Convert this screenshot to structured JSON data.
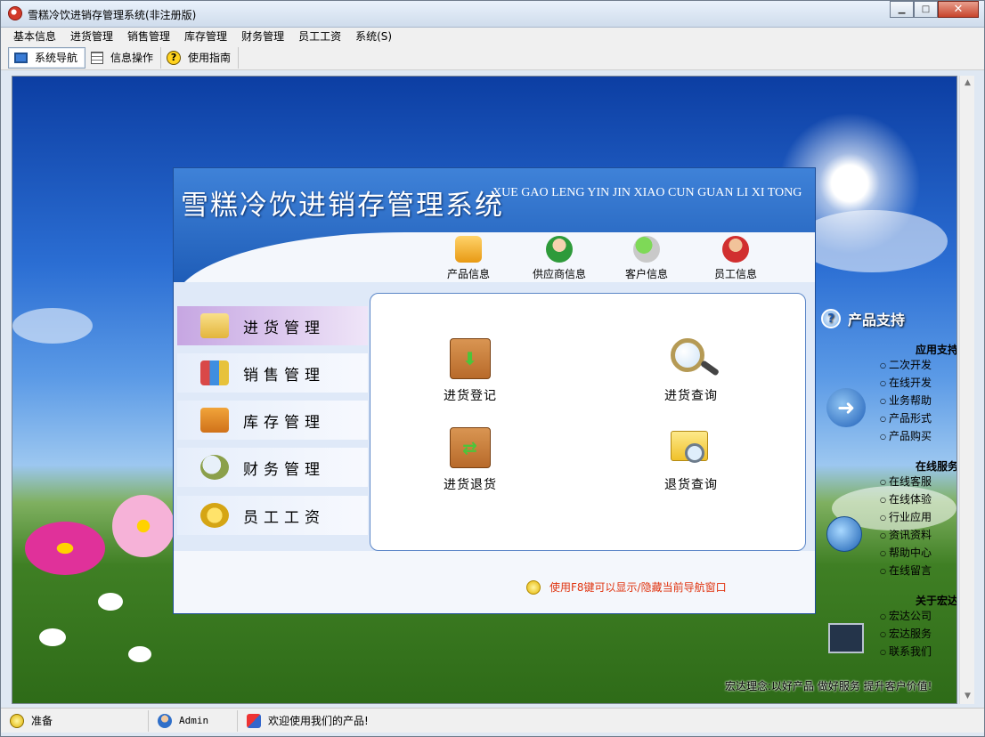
{
  "window": {
    "title": "雪糕冷饮进销存管理系统(非注册版)"
  },
  "menu": [
    "基本信息",
    "进货管理",
    "销售管理",
    "库存管理",
    "财务管理",
    "员工工资",
    "系统(S)"
  ],
  "toolbar": {
    "items": [
      {
        "label": "系统导航",
        "icon": "monitor-icon",
        "active": true
      },
      {
        "label": "信息操作",
        "icon": "grid-icon",
        "active": false
      },
      {
        "label": "使用指南",
        "icon": "help-icon",
        "active": false
      }
    ]
  },
  "nav": {
    "title": "雪糕冷饮进销存管理系统",
    "subtitle": "XUE GAO LENG YIN JIN XIAO CUN GUAN LI XI TONG",
    "quick": [
      {
        "label": "产品信息",
        "icon": "pencil-folder-icon"
      },
      {
        "label": "供应商信息",
        "icon": "person-icon"
      },
      {
        "label": "客户信息",
        "icon": "customer-icon"
      },
      {
        "label": "员工信息",
        "icon": "staff-icon"
      }
    ],
    "side": [
      {
        "label": "进货管理",
        "active": true
      },
      {
        "label": "销售管理",
        "active": false
      },
      {
        "label": "库存管理",
        "active": false
      },
      {
        "label": "财务管理",
        "active": false
      },
      {
        "label": "员工工资",
        "active": false
      }
    ],
    "actions": [
      {
        "label": "进货登记",
        "icon": "box-down-icon"
      },
      {
        "label": "进货查询",
        "icon": "magnifier-icon"
      },
      {
        "label": "进货退货",
        "icon": "box-return-icon"
      },
      {
        "label": "退货查询",
        "icon": "folder-search-icon"
      }
    ],
    "tip": "使用F8键可以显示/隐藏当前导航窗口"
  },
  "support": {
    "title": "产品支持",
    "sections": [
      {
        "title": "应用支持",
        "links": [
          "二次开发",
          "在线开发",
          "业务帮助",
          "产品形式",
          "产品购买"
        ]
      },
      {
        "title": "在线服务",
        "links": [
          "在线客服",
          "在线体验",
          "行业应用",
          "资讯资料",
          "帮助中心",
          "在线留言"
        ]
      },
      {
        "title": "关于宏达",
        "links": [
          "宏达公司",
          "宏达服务",
          "联系我们"
        ]
      }
    ],
    "slogan": "宏达理念:以好产品 做好服务 提升客户价值!"
  },
  "status": {
    "ready": "准备",
    "user": "Admin",
    "welcome": "欢迎使用我们的产品!"
  },
  "colors": {
    "accent": "#2f6fc9",
    "tip": "#e03410"
  }
}
